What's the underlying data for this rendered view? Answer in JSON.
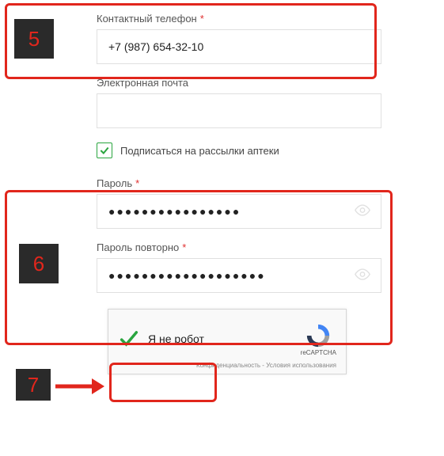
{
  "fields": {
    "phone": {
      "label": "Контактный телефон",
      "required": true,
      "value": "+7 (987) 654-32-10"
    },
    "email": {
      "label": "Электронная почта",
      "required": false,
      "value": ""
    },
    "subscribe": {
      "label": "Подписаться на рассылки аптеки",
      "checked": true
    },
    "password": {
      "label": "Пароль",
      "required": true,
      "masked": "●●●●●●●●●●●●●●●●"
    },
    "password2": {
      "label": "Пароль повторно",
      "required": true,
      "masked": "●●●●●●●●●●●●●●●●●●●"
    }
  },
  "recaptcha": {
    "label": "Я не робот",
    "brand": "reCAPTCHA",
    "footer": "Конфиденциальность - Условия использования",
    "checked": true
  },
  "annotations": {
    "step5": "5",
    "step6": "6",
    "step7": "7"
  }
}
